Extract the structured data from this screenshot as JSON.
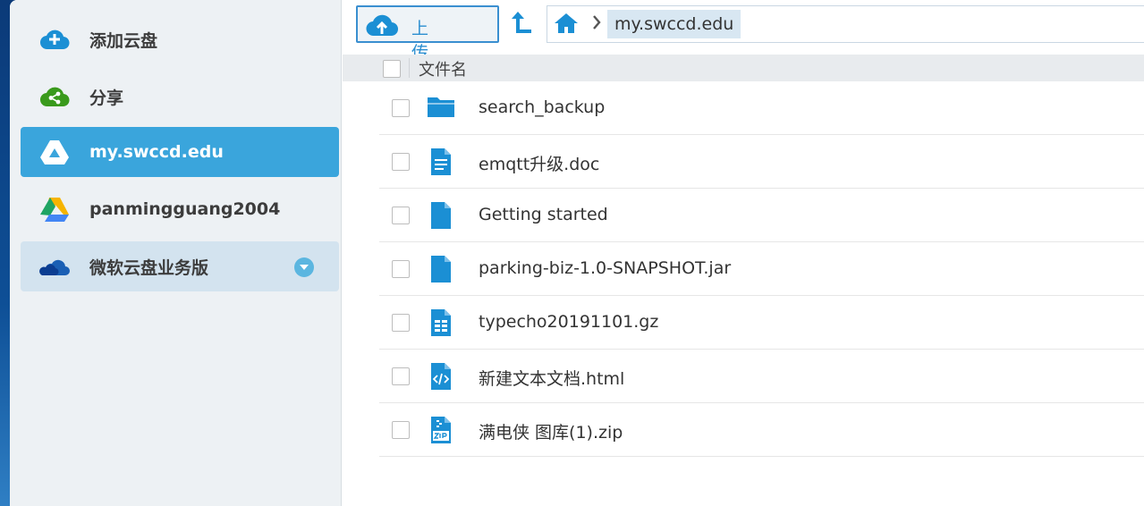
{
  "sidebar": {
    "items": [
      {
        "label": "添加云盘",
        "icon": "cloud-add-icon"
      },
      {
        "label": "分享",
        "icon": "cloud-share-icon"
      },
      {
        "label": "my.swccd.edu",
        "icon": "google-drive-icon",
        "active": true
      },
      {
        "label": "panmingguang2004",
        "icon": "google-drive-icon"
      },
      {
        "label": "微软云盘业务版",
        "icon": "onedrive-icon",
        "expanded": true
      }
    ]
  },
  "toolbar": {
    "upload_label": "上 传",
    "breadcrumb": [
      "my.swccd.edu"
    ]
  },
  "list": {
    "column_name": "文件名",
    "files": [
      {
        "name": "search_backup",
        "type": "folder"
      },
      {
        "name": "emqtt升级.doc",
        "type": "document"
      },
      {
        "name": "Getting started",
        "type": "file"
      },
      {
        "name": "parking-biz-1.0-SNAPSHOT.jar",
        "type": "file"
      },
      {
        "name": "typecho20191101.gz",
        "type": "spreadsheet"
      },
      {
        "name": "新建文本文档.html",
        "type": "code"
      },
      {
        "name": "满电侠 图库(1).zip",
        "type": "zip"
      }
    ]
  },
  "colors": {
    "accent": "#3aa5dc",
    "icon_blue": "#1b8fd4",
    "sidebar_bg": "#edf1f4",
    "header_bg": "#e8ebee"
  }
}
